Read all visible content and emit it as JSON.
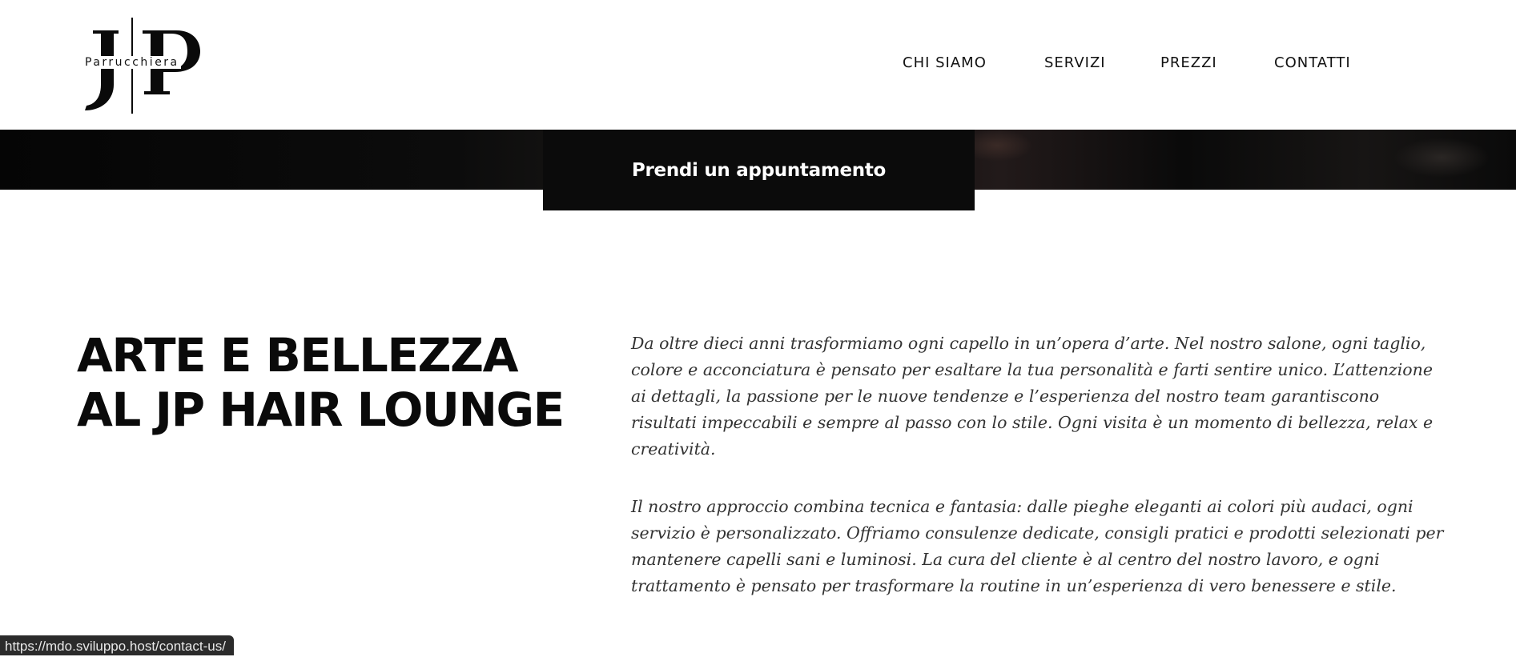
{
  "header": {
    "logo": {
      "letters": "JP",
      "tagline": "Parrucchiera"
    },
    "nav": [
      {
        "label": "CHI SIAMO"
      },
      {
        "label": "SERVIZI"
      },
      {
        "label": "PREZZI"
      },
      {
        "label": "CONTATTI"
      }
    ]
  },
  "hero": {
    "cta_label": "Prendi un appuntamento"
  },
  "main": {
    "headline": "ARTE E BELLEZZA AL JP HAIR LOUNGE",
    "paragraphs": [
      "Da oltre dieci anni trasformiamo ogni capello in un’opera d’arte. Nel nostro salone, ogni taglio, colore e acconciatura è pensato per esaltare la tua personalità e farti sentire unico. L’attenzione ai dettagli, la passione per le nuove tendenze e l’esperienza del nostro team garantiscono risultati impeccabili e sempre al passo con lo stile. Ogni visita è un momento di bellezza, relax e creatività.",
      "Il nostro approccio combina tecnica e fantasia: dalle pieghe eleganti ai colori più audaci, ogni servizio è personalizzato. Offriamo consulenze dedicate, consigli pratici e prodotti selezionati per mantenere capelli sani e luminosi. La cura del cliente è al centro del nostro lavoro, e ogni trattamento è pensato per trasformare la routine in un’esperienza di vero benessere e stile."
    ]
  },
  "statusbar": {
    "url": "https://mdo.sviluppo.host/contact-us/"
  },
  "colors": {
    "text": "#111111",
    "cta_bg": "#0b0b0b",
    "cta_text": "#ffffff",
    "paragraph": "#333333"
  }
}
